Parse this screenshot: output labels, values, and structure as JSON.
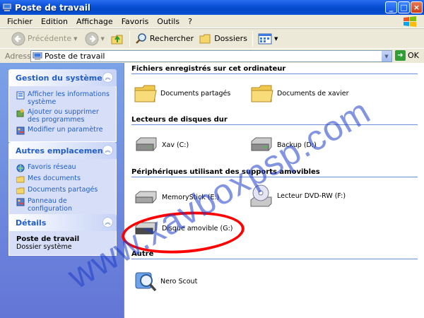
{
  "window": {
    "title": "Poste de travail"
  },
  "menu": [
    "Fichier",
    "Edition",
    "Affichage",
    "Favoris",
    "Outils",
    "?"
  ],
  "toolbar": {
    "back_label": "Précédente",
    "search_label": "Rechercher",
    "folders_label": "Dossiers"
  },
  "address": {
    "label": "Adresse",
    "value": "Poste de travail",
    "go_label": "OK"
  },
  "sidebar": {
    "system": {
      "title": "Gestion du système",
      "items": [
        {
          "label": "Afficher les informations système",
          "icon": "info-icon"
        },
        {
          "label": "Ajouter ou supprimer des programmes",
          "icon": "add-remove-icon"
        },
        {
          "label": "Modifier un paramètre",
          "icon": "control-panel-icon"
        }
      ]
    },
    "places": {
      "title": "Autres emplacements",
      "items": [
        {
          "label": "Favoris réseau",
          "icon": "network-icon"
        },
        {
          "label": "Mes documents",
          "icon": "folder-icon"
        },
        {
          "label": "Documents partagés",
          "icon": "folder-icon"
        },
        {
          "label": "Panneau de configuration",
          "icon": "control-panel-icon"
        }
      ]
    },
    "details": {
      "title": "Détails",
      "name": "Poste de travail",
      "sub": "Dossier système"
    }
  },
  "groups": {
    "files": {
      "title": "Fichiers enregistrés sur cet ordinateur",
      "items": [
        "Documents partagés",
        "Documents de xavier"
      ]
    },
    "drives": {
      "title": "Lecteurs de disques dur",
      "items": [
        "Xav (C:)",
        "Backup (D:)"
      ]
    },
    "removable": {
      "title": "Périphériques utilisant des supports amovibles",
      "items": [
        "MemoryStick (E:)",
        "Lecteur DVD-RW (F:)",
        "Disque amovible (G:)"
      ]
    },
    "other": {
      "title": "Autre",
      "items": [
        "Nero Scout"
      ]
    }
  },
  "watermark": "www.xavboxpsp.com",
  "colors": {
    "titlebar": "#0a52d8",
    "sidebar": "#6f8ede",
    "link": "#215dc6",
    "highlight": "#ff0000"
  }
}
